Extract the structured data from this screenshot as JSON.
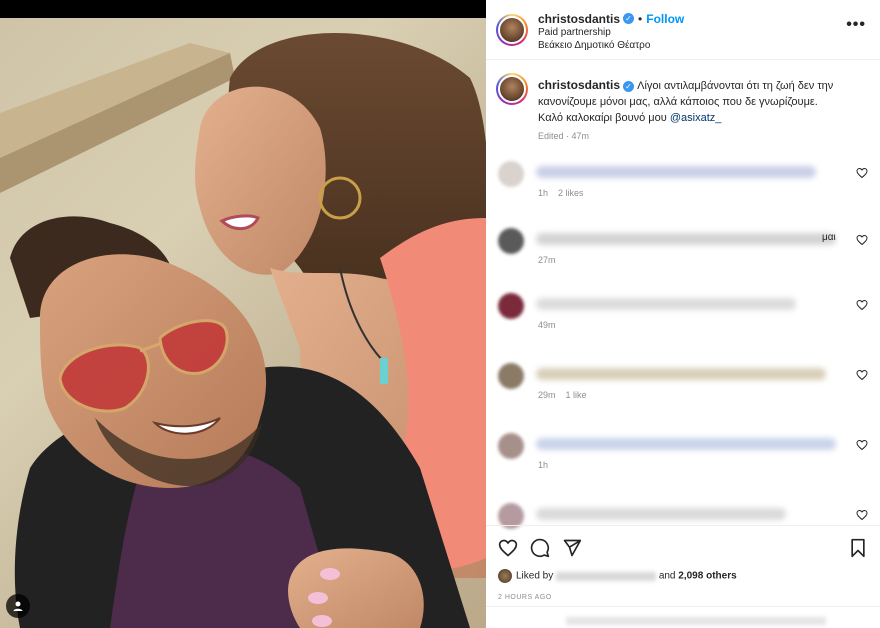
{
  "header": {
    "username": "christosdantis",
    "follow_label": "Follow",
    "subtitle_partnership": "Paid partnership",
    "location": "Βεάκειο Δημοτικό Θέατρο",
    "more_label": "•••"
  },
  "caption": {
    "username": "christosdantis",
    "text": "Λίγοι αντιλαμβάνονται ότι τη ζωή δεν την κανονίζουμε μόνοι μας, αλλά κάποιος που δε γνωρίζουμε. Καλό καλοκαίρι βουνό μου",
    "mention": "@asixatz_",
    "meta": "Edited · 47m"
  },
  "comments": [
    {
      "time": "1h",
      "likes": "2 likes",
      "avatar_color": "#d9d2cd",
      "blur_color": "#c9cfe6",
      "trail": ""
    },
    {
      "time": "27m",
      "likes": "",
      "avatar_color": "#5a5a5a",
      "blur_color": "#d4d4d4",
      "trail": "μαι"
    },
    {
      "time": "49m",
      "likes": "",
      "avatar_color": "#7a2a3a",
      "blur_color": "#dcdcdc",
      "trail": ""
    },
    {
      "time": "29m",
      "likes": "1 like",
      "avatar_color": "#8a7a66",
      "blur_color": "#d8cfb8",
      "trail": ""
    },
    {
      "time": "1h",
      "likes": "",
      "avatar_color": "#a6908a",
      "blur_color": "#c9d3ea",
      "trail": ""
    },
    {
      "time": "",
      "likes": "",
      "avatar_color": "#b59aa0",
      "blur_color": "#dadada",
      "trail": ""
    }
  ],
  "likes": {
    "prefix": "Liked by",
    "suffix_and": "and",
    "count": "2,098 others"
  },
  "timestamp": "2 HOURS AGO",
  "icons": [
    "verified-badge-icon",
    "more-options-icon",
    "heart-icon",
    "comment-icon",
    "share-icon",
    "bookmark-icon",
    "user-tag-icon"
  ],
  "colors": {
    "accent": "#0095f6",
    "verified": "#3897f0",
    "muted": "#8e8e8e"
  }
}
